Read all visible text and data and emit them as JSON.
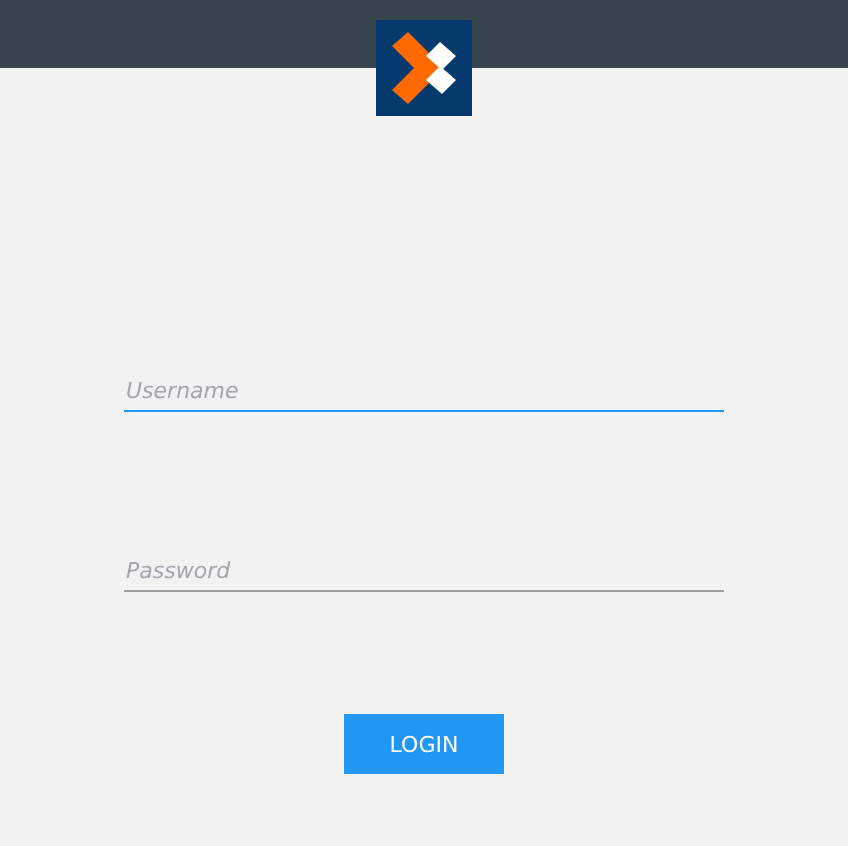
{
  "fields": [
    {
      "placeholder": "Username",
      "focused": true
    },
    {
      "placeholder": "Password",
      "focused": false
    }
  ],
  "login_button": {
    "label": "LOGIN"
  }
}
